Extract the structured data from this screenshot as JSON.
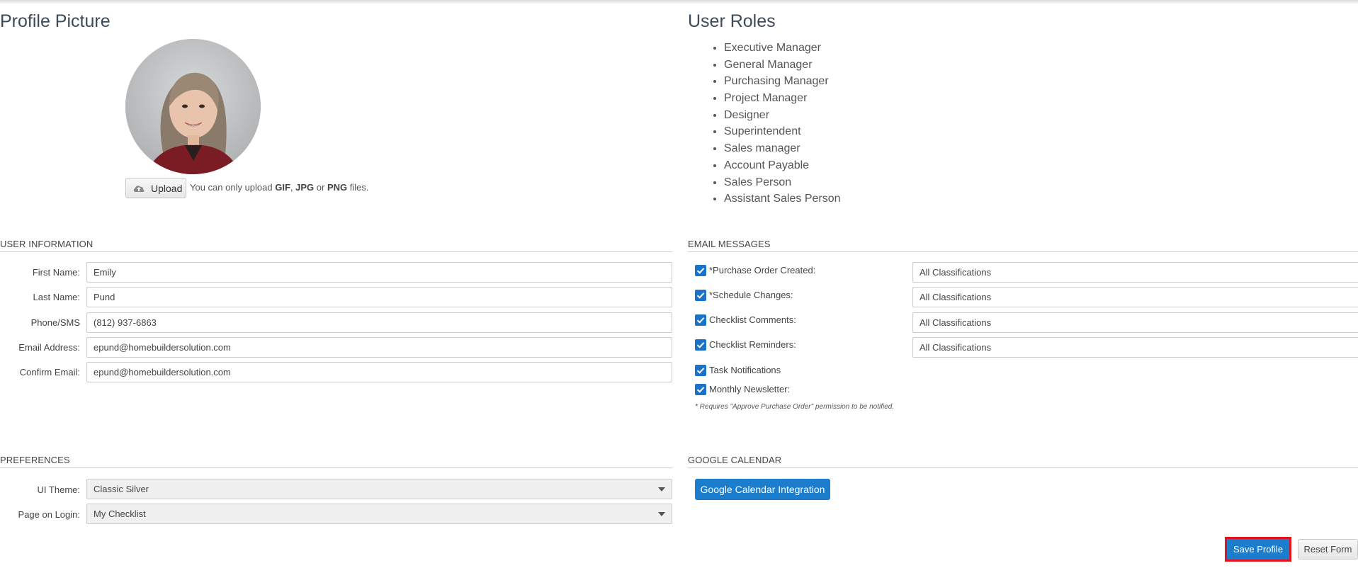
{
  "profile": {
    "title": "Profile Picture",
    "upload_label": "Upload",
    "note_prefix": "You can only upload ",
    "fmt1": "GIF",
    "sep1": ", ",
    "fmt2": "JPG",
    "sep2": " or ",
    "fmt3": "PNG",
    "note_suffix": " files."
  },
  "roles": {
    "title": "User Roles",
    "items": [
      "Executive Manager",
      "General Manager",
      "Purchasing Manager",
      "Project Manager",
      "Designer",
      "Superintendent",
      "Sales manager",
      "Account Payable",
      "Sales Person",
      "Assistant Sales Person"
    ]
  },
  "user_info": {
    "title": "USER INFORMATION",
    "fields": [
      {
        "label": "First Name:",
        "value": "Emily"
      },
      {
        "label": "Last Name:",
        "value": "Pund"
      },
      {
        "label": "Phone/SMS",
        "value": "(812) 937-6863"
      },
      {
        "label": "Email Address:",
        "value": "epund@homebuildersolution.com"
      },
      {
        "label": "Confirm Email:",
        "value": "epund@homebuildersolution.com"
      }
    ]
  },
  "email_messages": {
    "title": "EMAIL MESSAGES",
    "items": [
      {
        "label": "*Purchase Order Created:",
        "checked": true,
        "select": "All Classifications"
      },
      {
        "label": "*Schedule Changes:",
        "checked": true,
        "select": "All Classifications"
      },
      {
        "label": "Checklist Comments:",
        "checked": true,
        "select": "All Classifications"
      },
      {
        "label": "Checklist Reminders:",
        "checked": true,
        "select": "All Classifications"
      },
      {
        "label": "Task Notifications",
        "checked": true
      },
      {
        "label": "Monthly Newsletter:",
        "checked": true
      }
    ],
    "note": "* Requires \"Approve Purchase Order\" permission to be notified."
  },
  "preferences": {
    "title": "PREFERENCES",
    "fields": [
      {
        "label": "UI Theme:",
        "value": "Classic Silver"
      },
      {
        "label": "Page on Login:",
        "value": "My Checklist"
      }
    ]
  },
  "google_calendar": {
    "title": "GOOGLE CALENDAR",
    "button": "Google Calendar Integration"
  },
  "actions": {
    "save": "Save Profile",
    "reset": "Reset Form"
  },
  "colors": {
    "accent": "#1b7dcc",
    "highlight_border": "#e0141e"
  }
}
